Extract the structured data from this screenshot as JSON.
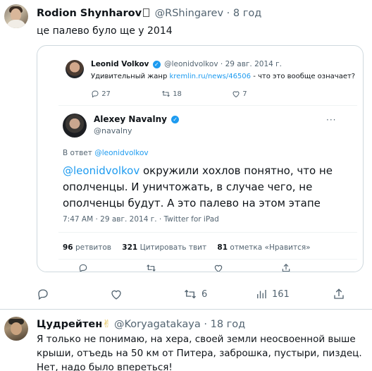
{
  "post1": {
    "author_name": "Rodion Shynharov",
    "author_handle": "@RShingarev",
    "separator": "·",
    "time": "8 год",
    "text": "це палево було ще у 2014",
    "embed": {
      "quoted": {
        "name": "Leonid Volkov",
        "handle": "@leonidvolkov",
        "separator": "·",
        "date": "29 авг. 2014 г.",
        "text_before": "Удивительный жанр",
        "link": "kremlin.ru/news/46506",
        "text_after": "- что это вообще означает?",
        "replies": "27",
        "retweets": "18",
        "likes": "7"
      },
      "main": {
        "name": "Alexey Navalny",
        "handle": "@navalny",
        "more": "···",
        "reply_prefix": "В ответ",
        "reply_handle": "@leonidvolkov",
        "mention": "@leonidvolkov",
        "text": " окружили хохлов понятно, что не ополченцы. И уничтожать, в случае чего, не ополченцы будут. А это палево на этом этапе",
        "meta": "7:47 AM · 29 авг. 2014 г. · Twitter for iPad",
        "stats": [
          {
            "count": "96",
            "label": "ретвитов"
          },
          {
            "count": "321",
            "label": "Цитировать твит"
          },
          {
            "count": "81",
            "label": "отметка «Нравится»"
          }
        ]
      }
    },
    "actions": {
      "retweets": "6",
      "views": "161"
    }
  },
  "post2": {
    "author_name": "Цудрейтен",
    "emoji": "✌",
    "author_handle": "@Koryagatakaya",
    "separator": "·",
    "time": "18 год",
    "text": "Я только не понимаю, на хера, своей земли неосвоенной выше крыши, отъедь на 50 км от Питера, заброшка, пустыри, пиздец. Нет, надо было впереться!"
  },
  "colors": {
    "accent": "#1d9bf0",
    "secondary_text": "#536471",
    "border": "#cfd9de"
  }
}
